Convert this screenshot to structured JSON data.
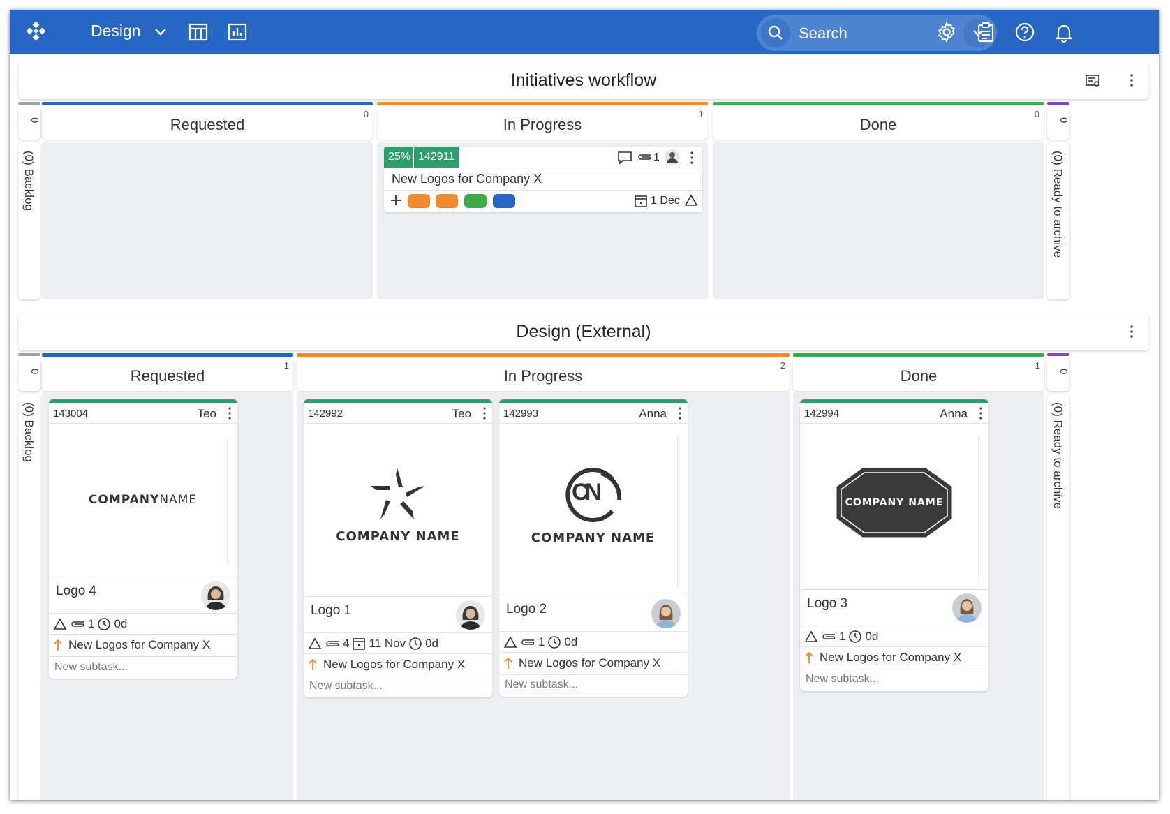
{
  "topbar": {
    "board_name": "Design",
    "search_placeholder": "Search"
  },
  "colors": {
    "brand": "#2767c3",
    "requested": "#2767c3",
    "in_progress": "#f08a2c",
    "done": "#3dac47",
    "archive": "#7a46c7",
    "progress_badge": "#2f9e6d"
  },
  "initiatives": {
    "title": "Initiatives workflow",
    "backlog": {
      "count": "0",
      "label": "(0) Backlog"
    },
    "archive": {
      "count": "0",
      "label": "(0) Ready to archive"
    },
    "columns": [
      {
        "label": "Requested",
        "count": "0"
      },
      {
        "label": "In Progress",
        "count": "1"
      },
      {
        "label": "Done",
        "count": "0"
      }
    ],
    "card": {
      "progress": "25%",
      "id": "142911",
      "attachments": "1",
      "title": "New Logos for Company X",
      "due": "1 Dec",
      "tag_colors": [
        "#f08a2c",
        "#f08a2c",
        "#3dac47",
        "#2767c3"
      ]
    }
  },
  "external": {
    "title": "Design (External)",
    "backlog": {
      "count": "0",
      "label": "(0) Backlog"
    },
    "archive": {
      "count": "0",
      "label": "(0) Ready to archive"
    },
    "columns": [
      {
        "label": "Requested",
        "count": "1"
      },
      {
        "label": "In Progress",
        "count": "2"
      },
      {
        "label": "Done",
        "count": "1"
      }
    ],
    "cards": [
      {
        "id": "143004",
        "owner": "Teo",
        "logo_text_a": "COMPANY",
        "logo_text_b": "NAME",
        "name": "Logo 4",
        "attachments": "1",
        "time": "0d",
        "parent": "New Logos for Company X",
        "subtask": "New subtask..."
      },
      {
        "id": "142992",
        "owner": "Teo",
        "logo_text": "COMPANY NAME",
        "name": "Logo 1",
        "attachments": "4",
        "date": "11 Nov",
        "time": "0d",
        "parent": "New Logos for Company X",
        "subtask": "New subtask..."
      },
      {
        "id": "142993",
        "owner": "Anna",
        "logo_text": "COMPANY NAME",
        "logo_mark": "CN",
        "name": "Logo 2",
        "attachments": "1",
        "time": "0d",
        "parent": "New Logos for Company X",
        "subtask": "New subtask..."
      },
      {
        "id": "142994",
        "owner": "Anna",
        "logo_text": "COMPANY NAME",
        "name": "Logo 3",
        "attachments": "1",
        "time": "0d",
        "parent": "New Logos for Company X",
        "subtask": "New subtask..."
      }
    ]
  }
}
